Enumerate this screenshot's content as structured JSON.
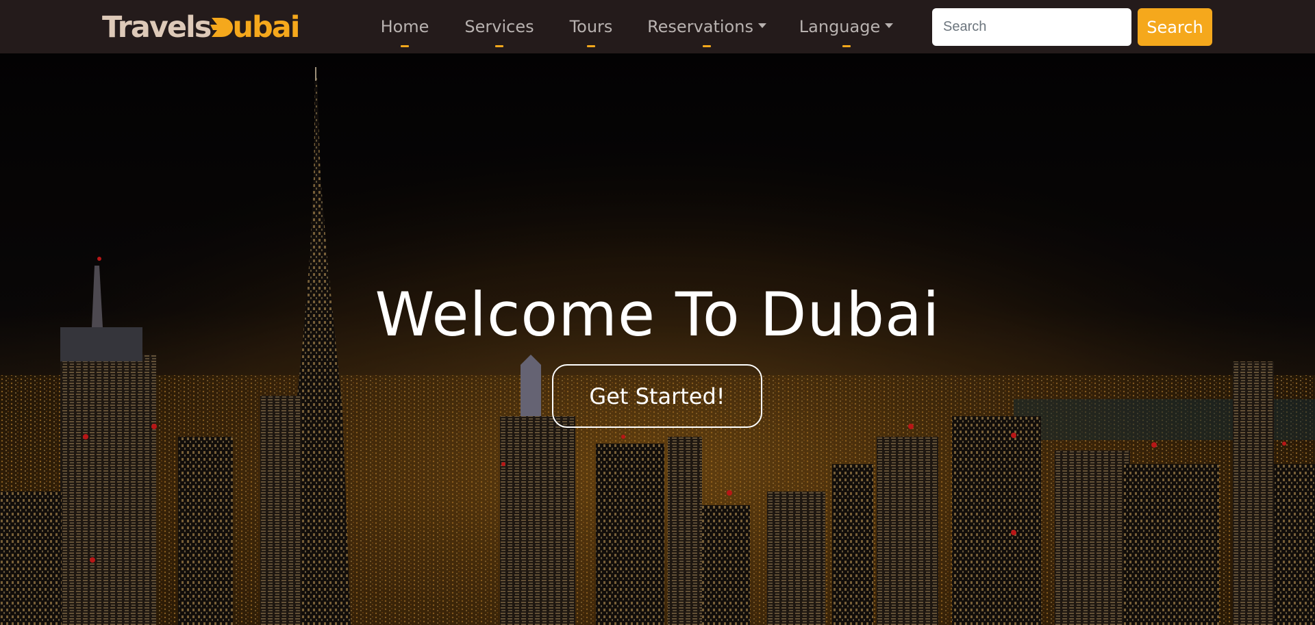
{
  "brand": {
    "part1": "Travels",
    "part2": "ubai",
    "accent_color": "#f5a81c",
    "logo_icon": "plane-d-icon"
  },
  "nav": {
    "items": [
      {
        "label": "Home",
        "dropdown": false
      },
      {
        "label": "Services",
        "dropdown": false
      },
      {
        "label": "Tours",
        "dropdown": false
      },
      {
        "label": "Reservations",
        "dropdown": true
      },
      {
        "label": "Language",
        "dropdown": true
      }
    ]
  },
  "search": {
    "placeholder": "Search",
    "value": "",
    "button_label": "Search"
  },
  "hero": {
    "title": "Welcome To Dubai",
    "cta_label": "Get Started!",
    "background": "dubai-night-skyline"
  },
  "colors": {
    "navbar": "#241b1b",
    "accent": "#f5a81c",
    "nav_text": "#b8b2b0"
  }
}
